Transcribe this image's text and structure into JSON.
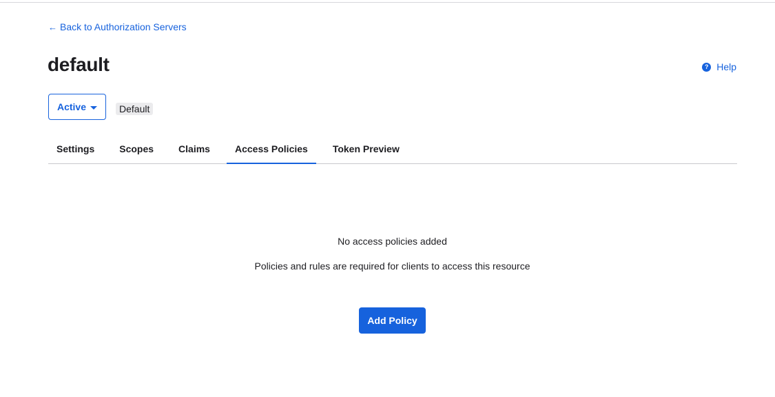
{
  "nav": {
    "back_arrow": "←",
    "back_label": "Back to Authorization Servers"
  },
  "header": {
    "title": "default",
    "help_label": "Help",
    "help_icon": "?"
  },
  "status": {
    "label": "Active",
    "badge": "Default"
  },
  "tabs": [
    {
      "label": "Settings"
    },
    {
      "label": "Scopes"
    },
    {
      "label": "Claims"
    },
    {
      "label": "Access Policies",
      "active": true
    },
    {
      "label": "Token Preview"
    }
  ],
  "empty_state": {
    "title": "No access policies added",
    "description": "Policies and rules are required for clients to access this resource",
    "button_label": "Add Policy"
  },
  "colors": {
    "accent": "#1662dd",
    "text": "#1d1d21",
    "badge_bg": "#ebebed"
  }
}
